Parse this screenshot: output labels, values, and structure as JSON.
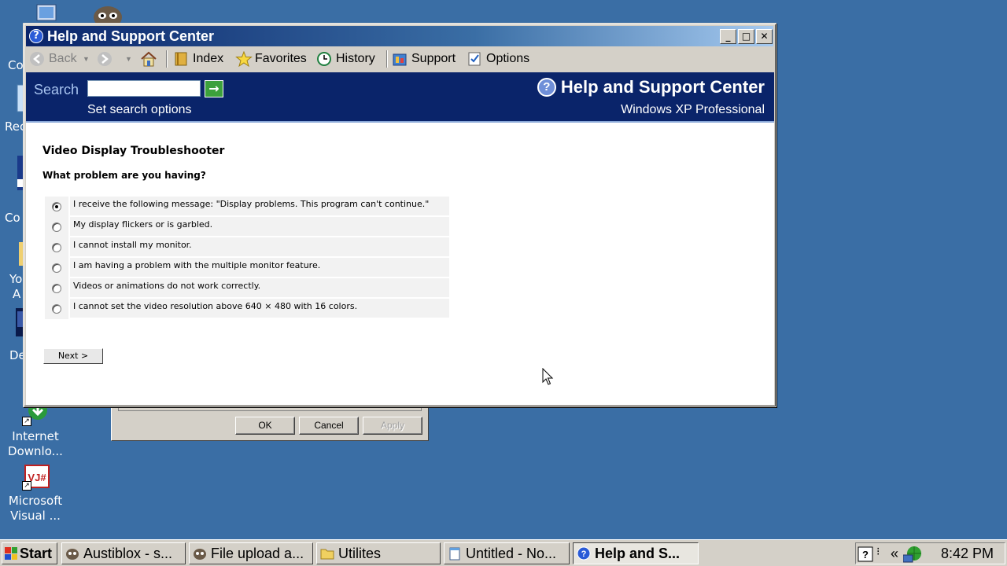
{
  "desktop": {
    "icons": [
      {
        "label_line1": "Internet",
        "label_line2": "Downlo..."
      },
      {
        "label_line1": "Microsoft",
        "label_line2": "Visual ..."
      }
    ],
    "partial_labels": [
      "Co",
      "Rec",
      "Co",
      "Yo",
      "A",
      "De"
    ]
  },
  "background_dialog": {
    "ok_label": "OK",
    "cancel_label": "Cancel",
    "apply_label": "Apply"
  },
  "window": {
    "title": "Help and Support Center",
    "minimize_glyph": "_",
    "maximize_glyph": "□",
    "close_glyph": "✕",
    "toolbar": {
      "back_label": "Back",
      "index_label": "Index",
      "favorites_label": "Favorites",
      "history_label": "History",
      "support_label": "Support",
      "options_label": "Options"
    },
    "header": {
      "search_label": "Search",
      "search_value": "",
      "search_options": "Set search options",
      "brand_title": "Help and Support Center",
      "brand_subtitle": "Windows XP Professional",
      "go_glyph": "→",
      "help_glyph": "?"
    },
    "content": {
      "heading": "Video Display Troubleshooter",
      "question": "What problem are you having?",
      "options": [
        {
          "label": "I receive the following message: \"Display problems. This program can't continue.\"",
          "checked": true
        },
        {
          "label": "My display flickers or is garbled.",
          "checked": false
        },
        {
          "label": "I cannot install my monitor.",
          "checked": false
        },
        {
          "label": "I am having a problem with the multiple monitor feature.",
          "checked": false
        },
        {
          "label": "Videos or animations do not work correctly.",
          "checked": false
        },
        {
          "label": "I cannot set the video resolution above 640 × 480 with 16 colors.",
          "checked": false
        }
      ],
      "next_label": "Next  >"
    }
  },
  "taskbar": {
    "start_label": "Start",
    "tasks": [
      {
        "label": "Austiblox - s...",
        "active": false
      },
      {
        "label": "File upload a...",
        "active": false
      },
      {
        "label": "Utilites",
        "active": false
      },
      {
        "label": "Untitled - No...",
        "active": false
      },
      {
        "label": "Help and S...",
        "active": true
      }
    ],
    "tray_chevron": "«",
    "clock": "8:42 PM"
  },
  "colors": {
    "desktop": "#3a6ea5",
    "header_band": "#0a246a",
    "title_gradient_start": "#0a246a",
    "title_gradient_end": "#a6caf0",
    "face": "#d4d0c8"
  }
}
